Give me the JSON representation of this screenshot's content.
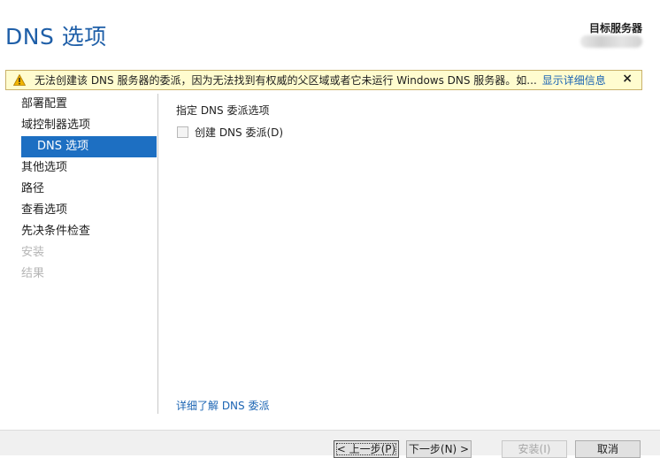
{
  "page": {
    "title": "DNS 选项",
    "target_label": "目标服务器"
  },
  "warning": {
    "icon": "warning-icon",
    "text": "无法创建该 DNS 服务器的委派，因为无法找到有权威的父区域或者它未运行 Windows DNS 服务器。如...",
    "link": "显示详细信息",
    "close": "×"
  },
  "nav": {
    "items": [
      {
        "label": "部署配置",
        "state": "normal"
      },
      {
        "label": "域控制器选项",
        "state": "normal"
      },
      {
        "label": "DNS 选项",
        "state": "active"
      },
      {
        "label": "其他选项",
        "state": "normal"
      },
      {
        "label": "路径",
        "state": "normal"
      },
      {
        "label": "查看选项",
        "state": "normal"
      },
      {
        "label": "先决条件检查",
        "state": "normal"
      },
      {
        "label": "安装",
        "state": "disabled"
      },
      {
        "label": "结果",
        "state": "disabled"
      }
    ]
  },
  "content": {
    "section_title": "指定 DNS 委派选项",
    "checkbox_label": "创建 DNS 委派(D)",
    "checkbox_checked": false,
    "learn_more": "详细了解 DNS 委派"
  },
  "footer": {
    "prev": "< 上一步(P)",
    "next": "下一步(N) >",
    "install": "安装(I)",
    "cancel": "取消"
  },
  "colors": {
    "accent": "#1d6fc2",
    "title": "#1f5fa8",
    "link": "#1b64b3",
    "warning_bg": "#fffccf"
  }
}
